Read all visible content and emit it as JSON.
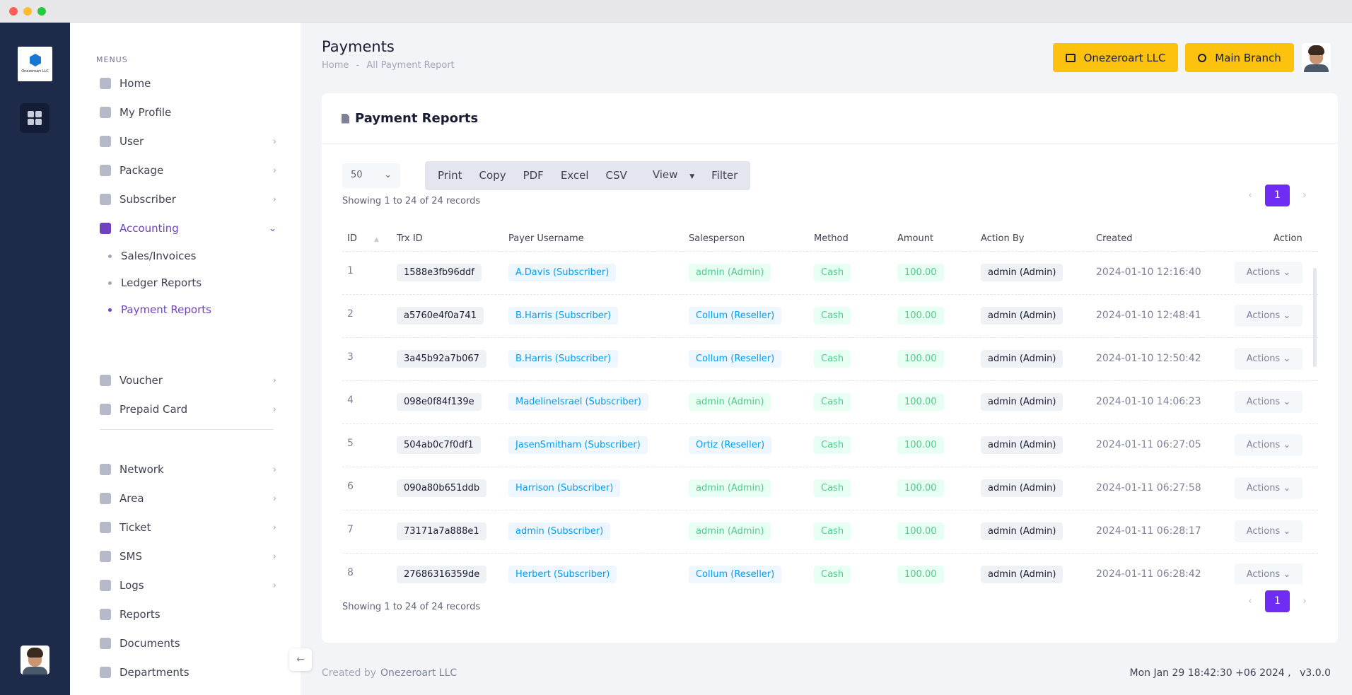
{
  "app": {
    "company_logo_text": "Onezeroart LLC"
  },
  "sidebar": {
    "section_label": "MENUS",
    "items": [
      {
        "label": "Home",
        "icon": "home-icon"
      },
      {
        "label": "My Profile",
        "icon": "user-icon"
      },
      {
        "label": "User",
        "icon": "user-icon"
      },
      {
        "label": "Package",
        "icon": "package-icon"
      },
      {
        "label": "Subscriber",
        "icon": "users-icon"
      },
      {
        "label": "Accounting",
        "icon": "calculator-icon"
      },
      {
        "label": "Voucher",
        "icon": "ticket-icon"
      },
      {
        "label": "Prepaid Card",
        "icon": "card-icon"
      },
      {
        "label": "Network",
        "icon": "antenna-icon"
      },
      {
        "label": "Area",
        "icon": "location-icon"
      },
      {
        "label": "Ticket",
        "icon": "mail-icon"
      },
      {
        "label": "SMS",
        "icon": "sms-icon"
      },
      {
        "label": "Logs",
        "icon": "logs-icon"
      },
      {
        "label": "Reports",
        "icon": "reports-icon"
      },
      {
        "label": "Documents",
        "icon": "document-icon"
      },
      {
        "label": "Departments",
        "icon": "building-icon"
      }
    ],
    "accounting_sub": [
      "Sales/Invoices",
      "Ledger Reports",
      "Payment Reports"
    ]
  },
  "header": {
    "title": "Payments",
    "breadcrumb_home": "Home",
    "breadcrumb_sep": "-",
    "breadcrumb_current": "All Payment Report",
    "company_button": "Onezeroart LLC",
    "branch_button": "Main Branch"
  },
  "card": {
    "title": "Payment Reports",
    "page_size": "50",
    "buttons": [
      "Print",
      "Copy",
      "PDF",
      "Excel",
      "CSV",
      "View",
      "Filter"
    ],
    "showing_text": "Showing 1 to 24 of 24 records",
    "current_page": "1",
    "columns": [
      "ID",
      "Trx ID",
      "Payer Username",
      "Salesperson",
      "Method",
      "Amount",
      "Action By",
      "Created",
      "Action"
    ],
    "rows": [
      {
        "id": "1",
        "trx": "1588e3fb96ddf",
        "payer": "A.Davis (Subscriber)",
        "sales": "admin (Admin)",
        "sales_type": "green",
        "method": "Cash",
        "amount": "100.00",
        "by": "admin (Admin)",
        "created": "2024-01-10 12:16:40",
        "action": "Actions"
      },
      {
        "id": "2",
        "trx": "a5760e4f0a741",
        "payer": "B.Harris (Subscriber)",
        "sales": "Collum (Reseller)",
        "sales_type": "blue",
        "method": "Cash",
        "amount": "100.00",
        "by": "admin (Admin)",
        "created": "2024-01-10 12:48:41",
        "action": "Actions"
      },
      {
        "id": "3",
        "trx": "3a45b92a7b067",
        "payer": "B.Harris (Subscriber)",
        "sales": "Collum (Reseller)",
        "sales_type": "blue",
        "method": "Cash",
        "amount": "100.00",
        "by": "admin (Admin)",
        "created": "2024-01-10 12:50:42",
        "action": "Actions"
      },
      {
        "id": "4",
        "trx": "098e0f84f139e",
        "payer": "MadelineIsrael (Subscriber)",
        "sales": "admin (Admin)",
        "sales_type": "green",
        "method": "Cash",
        "amount": "100.00",
        "by": "admin (Admin)",
        "created": "2024-01-10 14:06:23",
        "action": "Actions"
      },
      {
        "id": "5",
        "trx": "504ab0c7f0df1",
        "payer": "JasenSmitham (Subscriber)",
        "sales": "Ortiz (Reseller)",
        "sales_type": "blue",
        "method": "Cash",
        "amount": "100.00",
        "by": "admin (Admin)",
        "created": "2024-01-11 06:27:05",
        "action": "Actions"
      },
      {
        "id": "6",
        "trx": "090a80b651ddb",
        "payer": "Harrison (Subscriber)",
        "sales": "admin (Admin)",
        "sales_type": "green",
        "method": "Cash",
        "amount": "100.00",
        "by": "admin (Admin)",
        "created": "2024-01-11 06:27:58",
        "action": "Actions"
      },
      {
        "id": "7",
        "trx": "73171a7a888e1",
        "payer": "admin (Subscriber)",
        "sales": "admin (Admin)",
        "sales_type": "green",
        "method": "Cash",
        "amount": "100.00",
        "by": "admin (Admin)",
        "created": "2024-01-11 06:28:17",
        "action": "Actions"
      },
      {
        "id": "8",
        "trx": "27686316359de",
        "payer": "Herbert (Subscriber)",
        "sales": "Collum (Reseller)",
        "sales_type": "blue",
        "method": "Cash",
        "amount": "100.00",
        "by": "admin (Admin)",
        "created": "2024-01-11 06:28:42",
        "action": "Actions"
      }
    ]
  },
  "footer": {
    "created_by": "Created by",
    "company": "Onezeroart LLC",
    "datetime": "Mon Jan 29 18:42:30 +06 2024 ,",
    "version": "v3.0.0"
  },
  "colors": {
    "accent": "#6f42c1",
    "brand_yellow": "#fcc20e",
    "rail": "#1e2a4a",
    "page_active": "#6f2cf5"
  }
}
